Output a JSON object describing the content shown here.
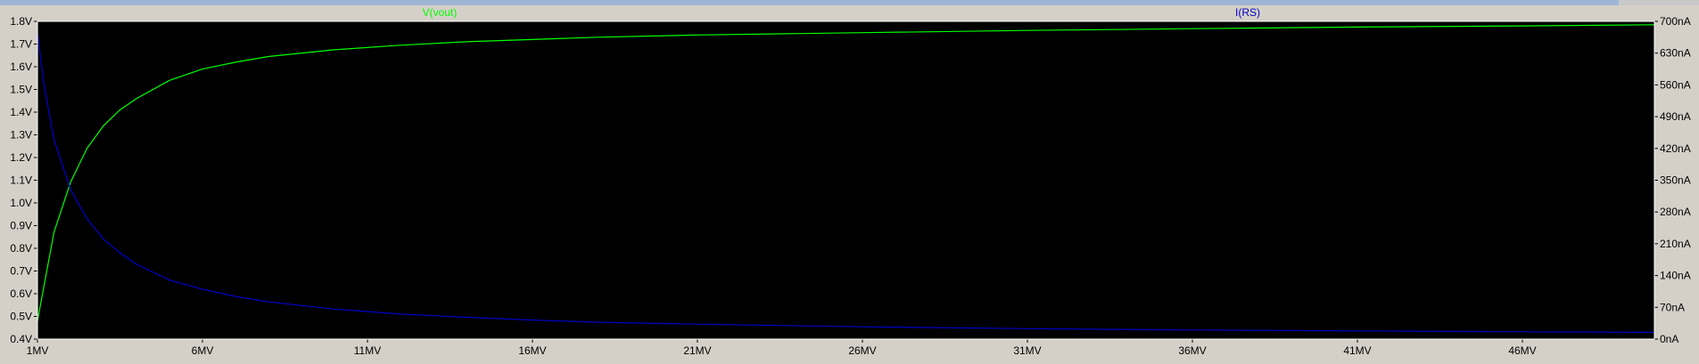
{
  "window": {
    "background": "#d4d0c8",
    "plot_background": "#000000",
    "frame_color": "#ffffff"
  },
  "chart_data": {
    "type": "line",
    "x": {
      "scale": "linear",
      "range": [
        1,
        50
      ],
      "tick_values": [
        1,
        6,
        11,
        16,
        21,
        26,
        31,
        36,
        41,
        46
      ],
      "tick_labels": [
        "1MV",
        "6MV",
        "11MV",
        "16MV",
        "21MV",
        "26MV",
        "31MV",
        "36MV",
        "41MV",
        "46MV"
      ]
    },
    "y_left": {
      "scale": "linear",
      "range": [
        0.4,
        1.8
      ],
      "tick_values": [
        0.4,
        0.5,
        0.6,
        0.7,
        0.8,
        0.9,
        1.0,
        1.1,
        1.2,
        1.3,
        1.4,
        1.5,
        1.6,
        1.7,
        1.8
      ],
      "tick_labels": [
        "0.4V",
        "0.5V",
        "0.6V",
        "0.7V",
        "0.8V",
        "0.9V",
        "1.0V",
        "1.1V",
        "1.2V",
        "1.3V",
        "1.4V",
        "1.5V",
        "1.6V",
        "1.7V",
        "1.8V"
      ]
    },
    "y_right": {
      "scale": "linear",
      "range": [
        0,
        700
      ],
      "tick_values": [
        0,
        70,
        140,
        210,
        280,
        350,
        420,
        490,
        560,
        630,
        700
      ],
      "tick_labels": [
        "0nA",
        "70nA",
        "140nA",
        "210nA",
        "280nA",
        "350nA",
        "420nA",
        "490nA",
        "560nA",
        "630nA",
        "700nA"
      ]
    },
    "grid": false,
    "series": [
      {
        "name": "V(vout)",
        "color": "#00ff00",
        "axis": "left",
        "x": [
          1,
          1.5,
          2,
          2.5,
          3,
          3.5,
          4,
          5,
          6,
          7,
          8,
          10,
          12,
          14,
          16,
          18,
          21,
          26,
          31,
          36,
          41,
          46,
          50
        ],
        "y": [
          0.48,
          0.87,
          1.09,
          1.24,
          1.34,
          1.41,
          1.46,
          1.54,
          1.59,
          1.62,
          1.645,
          1.675,
          1.695,
          1.71,
          1.72,
          1.73,
          1.74,
          1.75,
          1.76,
          1.768,
          1.775,
          1.78,
          1.785
        ]
      },
      {
        "name": "I(RS)",
        "color": "#0000c8",
        "axis": "right",
        "x": [
          1,
          1.2,
          1.5,
          2,
          2.5,
          3,
          3.5,
          4,
          5,
          6,
          7,
          8,
          10,
          12,
          14,
          16,
          18,
          21,
          26,
          31,
          36,
          41,
          46,
          50
        ],
        "y": [
          675,
          560,
          440,
          330,
          265,
          220,
          190,
          165,
          130,
          110,
          94,
          82,
          66,
          55,
          48,
          42,
          37,
          33,
          27,
          23,
          20,
          18,
          16,
          15
        ]
      }
    ]
  }
}
